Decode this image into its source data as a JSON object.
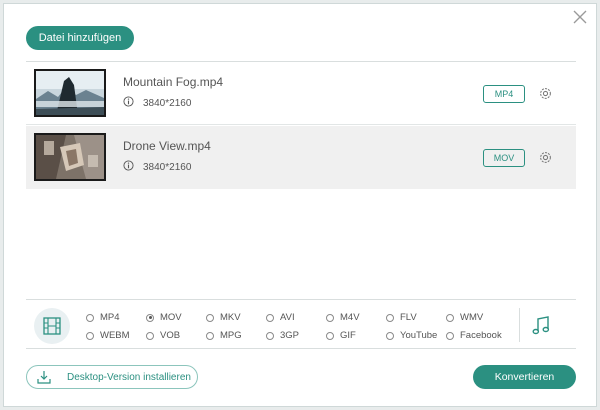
{
  "toolbar": {
    "add_file_label": "Datei hinzufügen"
  },
  "files": [
    {
      "name": "Mountain Fog.mp4",
      "resolution": "3840*2160",
      "format": "MP4"
    },
    {
      "name": "Drone View.mp4",
      "resolution": "3840*2160",
      "format": "MOV"
    }
  ],
  "formats": {
    "selected": "MOV",
    "row1": [
      "MP4",
      "MOV",
      "MKV",
      "AVI",
      "M4V",
      "FLV",
      "WMV"
    ],
    "row2": [
      "WEBM",
      "VOB",
      "MPG",
      "3GP",
      "GIF",
      "YouTube",
      "Facebook"
    ]
  },
  "footer": {
    "desktop_label": "Desktop-Version installieren",
    "convert_label": "Konvertieren"
  },
  "colors": {
    "accent": "#2b9081",
    "row_alt": "#f0f0f0"
  },
  "icons": [
    "close-icon",
    "info-icon",
    "gear-icon",
    "film-icon",
    "music-icon",
    "download-icon"
  ]
}
